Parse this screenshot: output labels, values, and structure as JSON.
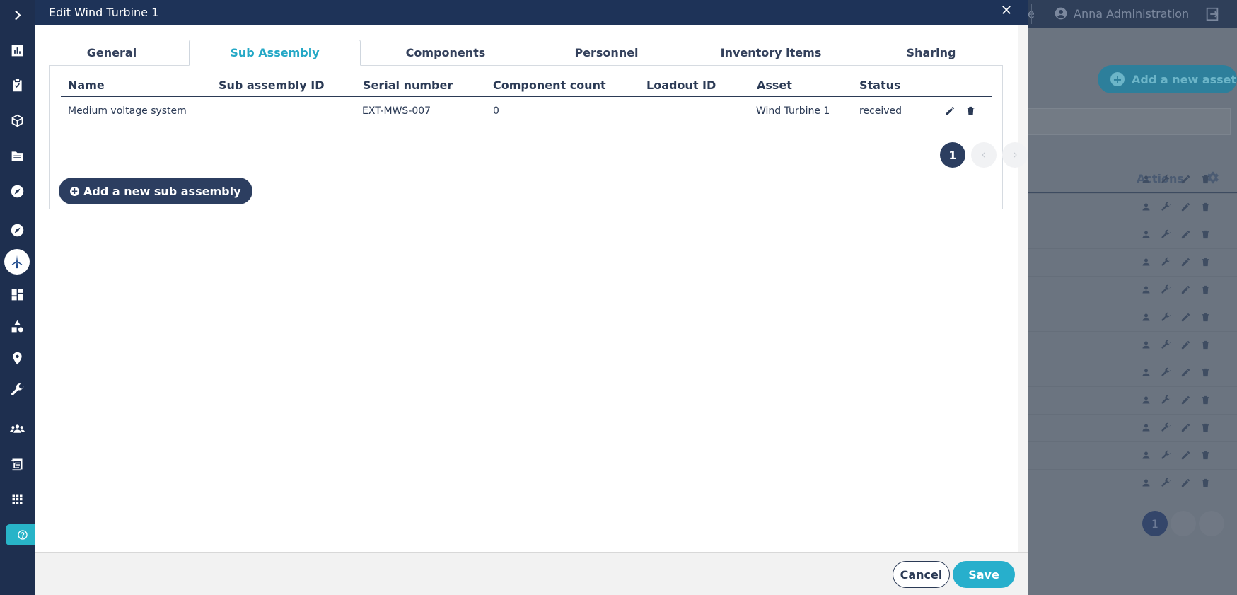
{
  "modal": {
    "title": "Edit Wind Turbine 1",
    "tabs": [
      {
        "label": "General"
      },
      {
        "label": "Sub Assembly"
      },
      {
        "label": "Components"
      },
      {
        "label": "Personnel"
      },
      {
        "label": "Inventory items"
      },
      {
        "label": "Sharing"
      }
    ],
    "active_tab": "Sub Assembly",
    "table": {
      "columns": [
        "Name",
        "Sub assembly ID",
        "Serial number",
        "Component count",
        "Loadout ID",
        "Asset",
        "Status"
      ],
      "rows": [
        {
          "name": "Medium voltage system",
          "sub_assembly_id": "",
          "serial_number": "EXT-MWS-007",
          "component_count": "0",
          "loadout_id": "",
          "asset": "Wind Turbine 1",
          "status": "received"
        }
      ]
    },
    "pagination": {
      "current": "1"
    },
    "add_button": "Add a new sub assembly",
    "footer": {
      "cancel": "Cancel",
      "save": "Save"
    }
  },
  "background": {
    "topbar_fragment": "e",
    "user_name": "Anna Administration",
    "add_asset_label": "Add a new asset",
    "actions_header": "Actions",
    "page": "1"
  },
  "colors": {
    "sidebar": "#1e2f4f",
    "modal_header": "#1e3358",
    "accent": "#27afcc",
    "primary_button": "#2c3e60"
  }
}
